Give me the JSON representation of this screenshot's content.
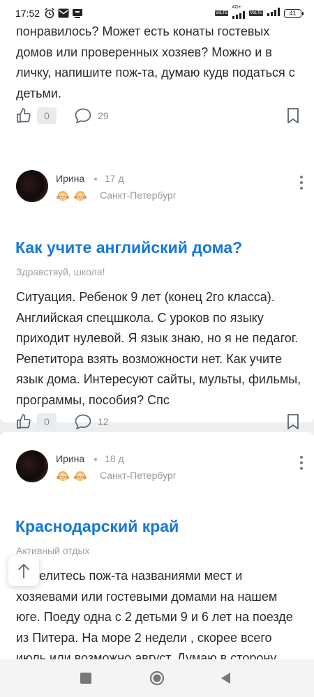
{
  "status_bar": {
    "time": "17:52",
    "network_tag_1": "VoLTE",
    "network_type": "4G+",
    "network_tag_2": "VoLTE",
    "battery": "41",
    "icons": [
      "alarm-icon",
      "mail-icon",
      "teams-icon",
      "signal-icon",
      "battery-icon"
    ]
  },
  "posts": [
    {
      "text": "понравилось? Может есть конаты гостевых домов или проверенных хозяев? Можно и в личку, напишите пож-та, думаю кудв податься с детьми.",
      "likes": "0",
      "comments": "29"
    },
    {
      "author": "Ирина",
      "time_ago": "17 д",
      "city": "Санкт-Петербург",
      "title": "Как учите английский дома?",
      "category": "Здравствуй, школа!",
      "text": "Ситуация. Ребенок 9 лет (конец 2го класса). Английская спецшкола. С уроков по языку приходит нулевой. Я язык знаю, но я не педагог. Репетитора взять возможности нет. Как учите язык дома. Интересуют сайты, мульты, фильмы, программы, пособия? Спс",
      "likes": "0",
      "comments": "12"
    },
    {
      "author": "Ирина",
      "time_ago": "18 д",
      "city": "Санкт-Петербург",
      "title": "Краснодарский край",
      "category": "Активный отдых",
      "text": "Поделитесь пож-та названиями мест и хозяевами или гостевыми домами на нашем юге. Поеду одна с 2 детьми 9 и 6 лет на поезде из Питера. На море 2 недели , скорее всего июль или возможно август. Думаю в сторону гостевых домов, чтобы самим делать"
    }
  ],
  "colors": {
    "title_blue": "#1479d6",
    "background": "#eceef0",
    "meta_gray": "#999999"
  }
}
